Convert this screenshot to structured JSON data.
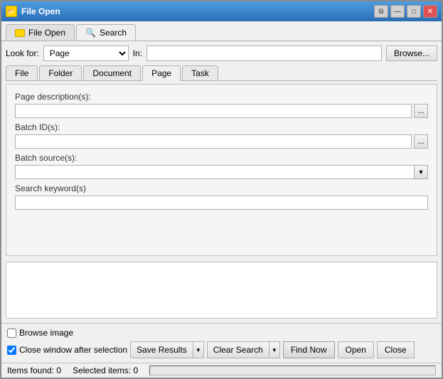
{
  "window": {
    "title": "File Open",
    "title_btn_minimize": "—",
    "title_btn_restore": "□",
    "title_btn_close": "✕"
  },
  "tabs": [
    {
      "id": "file-open",
      "label": "File Open",
      "active": false
    },
    {
      "id": "search",
      "label": "Search",
      "active": true
    }
  ],
  "look_for": {
    "label": "Look for:",
    "value": "Page",
    "in_label": "In:",
    "browse_label": "Browse..."
  },
  "inner_tabs": [
    {
      "label": "File",
      "active": false
    },
    {
      "label": "Folder",
      "active": false
    },
    {
      "label": "Document",
      "active": false
    },
    {
      "label": "Page",
      "active": true
    },
    {
      "label": "Task",
      "active": false
    }
  ],
  "form": {
    "page_desc_label": "Page description(s):",
    "batch_id_label": "Batch ID(s):",
    "batch_source_label": "Batch source(s):",
    "search_keyword_label": "Search keyword(s)"
  },
  "bottom": {
    "browse_image_label": "Browse image",
    "close_window_label": "Close window after selection",
    "save_results_label": "Save Results",
    "clear_search_label": "Clear Search",
    "find_now_label": "Find Now",
    "open_label": "Open",
    "close_label": "Close"
  },
  "status": {
    "items_found_label": "Items found:",
    "items_found_value": "0",
    "selected_items_label": "Selected items:",
    "selected_items_value": "0"
  }
}
